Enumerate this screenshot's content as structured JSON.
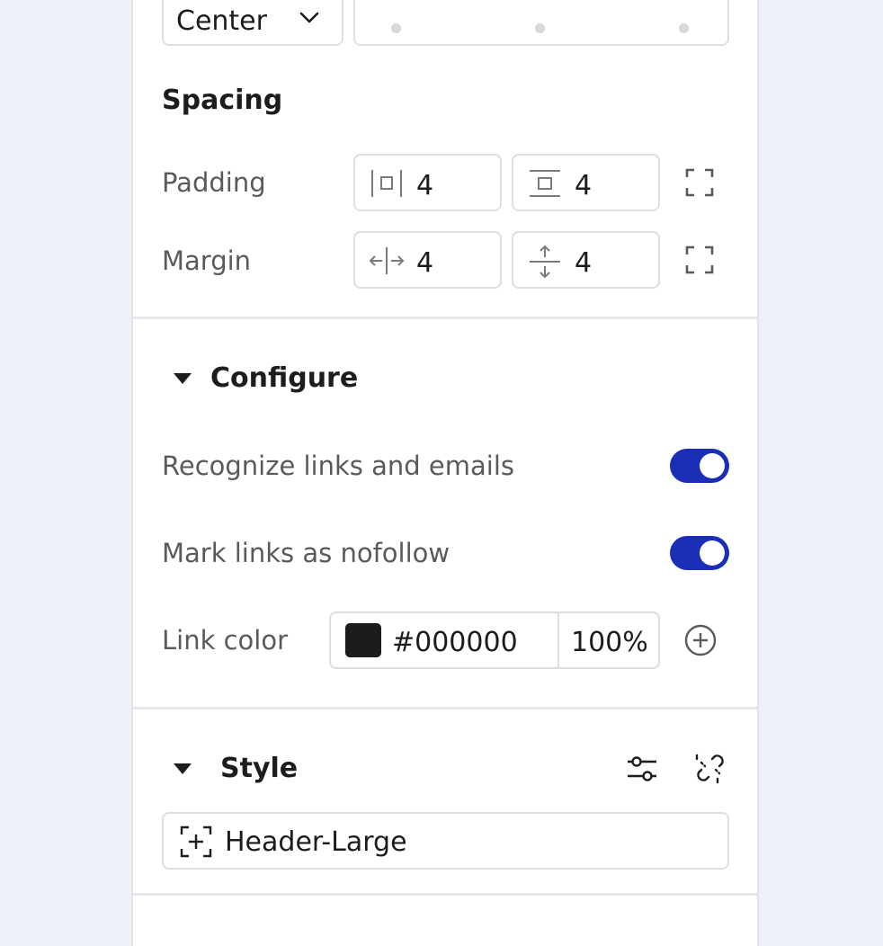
{
  "alignment": {
    "value": "Center"
  },
  "spacing": {
    "title": "Spacing",
    "padding": {
      "label": "Padding",
      "horizontal": "4",
      "vertical": "4"
    },
    "margin": {
      "label": "Margin",
      "horizontal": "4",
      "vertical": "4"
    }
  },
  "configure": {
    "title": "Configure",
    "recognize_links": {
      "label": "Recognize links and emails",
      "enabled": true
    },
    "nofollow": {
      "label": "Mark links as nofollow",
      "enabled": true
    },
    "link_color": {
      "label": "Link color",
      "hex": "#000000",
      "opacity": "100%",
      "swatch": "#1c1c1c"
    }
  },
  "style": {
    "title": "Style",
    "selected": "Header-Large"
  },
  "colors": {
    "accent": "#1a2eb8",
    "border": "#dcdee2",
    "background": "#eef2f8"
  },
  "icons": [
    "chevron-down-icon",
    "padding-horizontal-icon",
    "padding-vertical-icon",
    "margin-horizontal-icon",
    "margin-vertical-icon",
    "expand-corners-icon",
    "caret-down-icon",
    "add-circle-icon",
    "sliders-icon",
    "unlink-icon",
    "style-add-icon"
  ]
}
